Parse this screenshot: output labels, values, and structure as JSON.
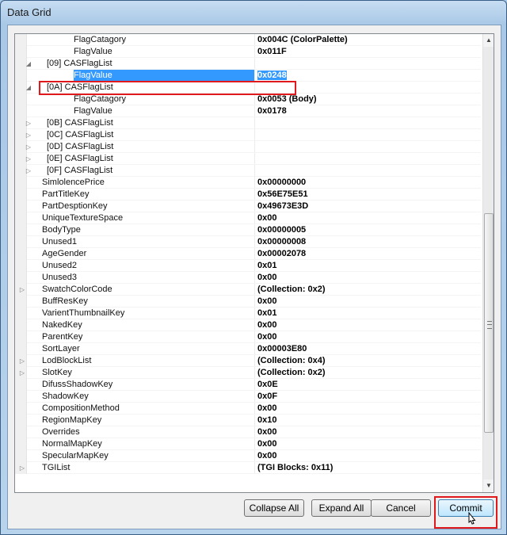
{
  "window": {
    "title": "Data Grid"
  },
  "rows": [
    {
      "indent": 3,
      "expander": "",
      "name": "FlagCatagory",
      "value": "0x004C (ColorPalette)"
    },
    {
      "indent": 3,
      "expander": "",
      "name": "FlagValue",
      "value": "0x011F"
    },
    {
      "indent": 2,
      "expander": "open",
      "name": "[09] CASFlagList",
      "value": ""
    },
    {
      "indent": 3,
      "expander": "",
      "name": "FlagValue",
      "value": "0x0248",
      "selected": true
    },
    {
      "indent": 2,
      "expander": "open",
      "name": "[0A] CASFlagList",
      "value": ""
    },
    {
      "indent": 3,
      "expander": "",
      "name": "FlagCatagory",
      "value": "0x0053 (Body)"
    },
    {
      "indent": 3,
      "expander": "",
      "name": "FlagValue",
      "value": "0x0178"
    },
    {
      "indent": 2,
      "expander": "closed",
      "name": "[0B] CASFlagList",
      "value": ""
    },
    {
      "indent": 2,
      "expander": "closed",
      "name": "[0C] CASFlagList",
      "value": ""
    },
    {
      "indent": 2,
      "expander": "closed",
      "name": "[0D] CASFlagList",
      "value": ""
    },
    {
      "indent": 2,
      "expander": "closed",
      "name": "[0E] CASFlagList",
      "value": ""
    },
    {
      "indent": 2,
      "expander": "closed",
      "name": "[0F] CASFlagList",
      "value": ""
    },
    {
      "indent": 1,
      "expander": "",
      "name": "SimlolencePrice",
      "value": "0x00000000"
    },
    {
      "indent": 1,
      "expander": "",
      "name": "PartTitleKey",
      "value": "0x56E75E51"
    },
    {
      "indent": 1,
      "expander": "",
      "name": "PartDesptionKey",
      "value": "0x49673E3D"
    },
    {
      "indent": 1,
      "expander": "",
      "name": "UniqueTextureSpace",
      "value": "0x00"
    },
    {
      "indent": 1,
      "expander": "",
      "name": "BodyType",
      "value": "0x00000005"
    },
    {
      "indent": 1,
      "expander": "",
      "name": "Unused1",
      "value": "0x00000008"
    },
    {
      "indent": 1,
      "expander": "",
      "name": "AgeGender",
      "value": "0x00002078"
    },
    {
      "indent": 1,
      "expander": "",
      "name": "Unused2",
      "value": "0x01"
    },
    {
      "indent": 1,
      "expander": "",
      "name": "Unused3",
      "value": "0x00"
    },
    {
      "indent": 1,
      "expander": "closed",
      "name": "SwatchColorCode",
      "value": "(Collection: 0x2)"
    },
    {
      "indent": 1,
      "expander": "",
      "name": "BuffResKey",
      "value": "0x00"
    },
    {
      "indent": 1,
      "expander": "",
      "name": "VarientThumbnailKey",
      "value": "0x01"
    },
    {
      "indent": 1,
      "expander": "",
      "name": "NakedKey",
      "value": "0x00"
    },
    {
      "indent": 1,
      "expander": "",
      "name": "ParentKey",
      "value": "0x00"
    },
    {
      "indent": 1,
      "expander": "",
      "name": "SortLayer",
      "value": "0x00003E80"
    },
    {
      "indent": 1,
      "expander": "closed",
      "name": "LodBlockList",
      "value": "(Collection: 0x4)"
    },
    {
      "indent": 1,
      "expander": "closed",
      "name": "SlotKey",
      "value": "(Collection: 0x2)"
    },
    {
      "indent": 1,
      "expander": "",
      "name": "DifussShadowKey",
      "value": "0x0E"
    },
    {
      "indent": 1,
      "expander": "",
      "name": "ShadowKey",
      "value": "0x0F"
    },
    {
      "indent": 1,
      "expander": "",
      "name": "CompositionMethod",
      "value": "0x00"
    },
    {
      "indent": 1,
      "expander": "",
      "name": "RegionMapKey",
      "value": "0x10"
    },
    {
      "indent": 1,
      "expander": "",
      "name": "Overrides",
      "value": "0x00"
    },
    {
      "indent": 1,
      "expander": "",
      "name": "NormalMapKey",
      "value": "0x00"
    },
    {
      "indent": 1,
      "expander": "",
      "name": "SpecularMapKey",
      "value": "0x00"
    },
    {
      "indent": 1,
      "expander": "closed",
      "name": "TGIList",
      "value": "(TGI Blocks: 0x11)"
    }
  ],
  "scrollbar": {
    "position": 0.78
  },
  "buttons": {
    "collapse_all": "Collapse All",
    "expand_all": "Expand All",
    "cancel": "Cancel",
    "commit": "Commit"
  },
  "colors": {
    "selection": "#3399ff",
    "highlight_box": "#e0191d"
  }
}
